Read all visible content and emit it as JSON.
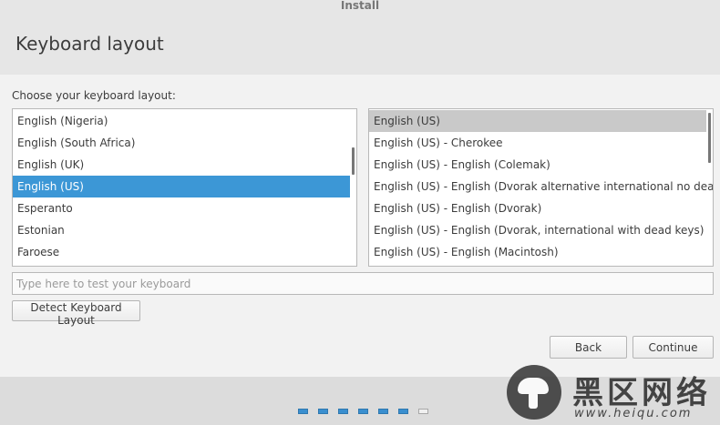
{
  "window": {
    "title": "Install"
  },
  "header": {
    "title": "Keyboard layout"
  },
  "prompt": "Choose your keyboard layout:",
  "layouts": [
    "English (Nigeria)",
    "English (South Africa)",
    "English (UK)",
    "English (US)",
    "Esperanto",
    "Estonian",
    "Faroese"
  ],
  "selected_layout": "English (US)",
  "variants": [
    "English (US)",
    "English (US) - Cherokee",
    "English (US) - English (Colemak)",
    "English (US) - English (Dvorak alternative international no dead keys)",
    "English (US) - English (Dvorak)",
    "English (US) - English (Dvorak, international with dead keys)",
    "English (US) - English (Macintosh)"
  ],
  "selected_variant": "English (US)",
  "test_input": {
    "value": "",
    "placeholder": "Type here to test your keyboard"
  },
  "buttons": {
    "detect": "Detect Keyboard Layout",
    "back": "Back",
    "continue": "Continue"
  },
  "progress": {
    "total_steps": 7,
    "completed_steps": 6
  },
  "watermark": {
    "brand": "黑区网络",
    "url": "www.heiqu.com"
  },
  "colors": {
    "selection": "#3c97d6",
    "selection_inactive": "#c9c9c9",
    "progress_done": "#3a8fcf"
  }
}
